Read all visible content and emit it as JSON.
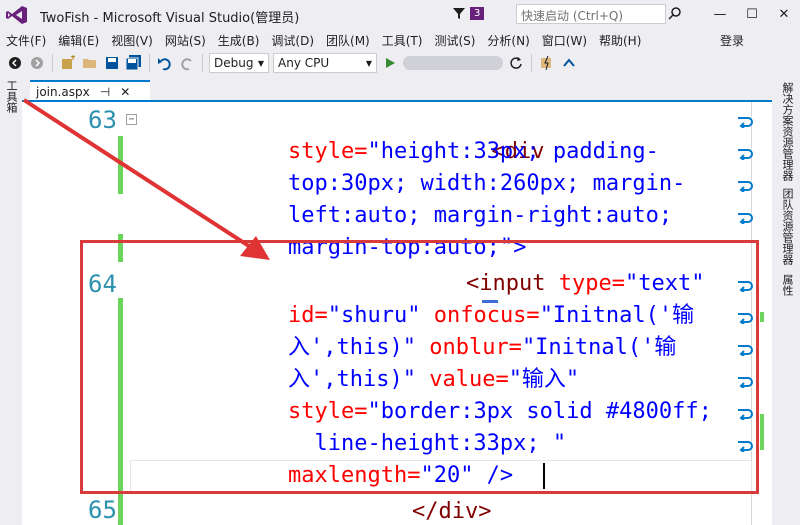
{
  "titlebar": {
    "title": "TwoFish - Microsoft Visual Studio(管理员)",
    "notifications": "3",
    "quick_launch_placeholder": "快速启动 (Ctrl+Q)",
    "minimize": "—",
    "maximize": "☐",
    "close": "✕"
  },
  "menu": {
    "items": [
      "文件(F)",
      "编辑(E)",
      "视图(V)",
      "网站(S)",
      "生成(B)",
      "调试(D)",
      "团队(M)",
      "工具(T)",
      "测试(S)",
      "分析(N)",
      "窗口(W)",
      "帮助(H)"
    ],
    "login": "登录"
  },
  "toolbar": {
    "config": "Debug",
    "platform": "Any CPU"
  },
  "left_strip": {
    "toolbox": "工具箱"
  },
  "right_strip": {
    "tabs": [
      "解决方案资源管理器",
      "团队资源管理器",
      "属性"
    ]
  },
  "tab": {
    "name": "join.aspx",
    "pin": "⊣",
    "close": "✕"
  },
  "editor": {
    "line_numbers": [
      "63",
      "64",
      "65"
    ],
    "code": {
      "l1_tag": "<div",
      "l2_attr": "style=",
      "l2_val": "\"height:33px; padding-",
      "l3_val": "top:30px; width:260px; margin-",
      "l4_val": "left:auto; margin-right:auto;",
      "l5_val": "margin-top:auto;\"",
      "l5_end": ">",
      "l6_tag": "<input",
      "l6_attr": " type=",
      "l6_val": "\"text\"",
      "l7_attr": "id=",
      "l7_val": "\"shuru\"",
      "l7_attr2": " onfocus=",
      "l7_val2": "\"Initnal('输",
      "l8_val": "入',this)\"",
      "l8_attr": " onblur=",
      "l8_val2": "\"Initnal('输",
      "l9_val": "入',this)\"",
      "l9_attr": " value=",
      "l9_val2": "\"输入\"",
      "l10_attr": "style=",
      "l10_val": "\"border:3px solid #4800ff;",
      "l11_val": "  line-height:33px; \"",
      "l12_attr": "maxlength=",
      "l12_val": "\"20\"",
      "l12_end": " />",
      "l13_tag": "</div>"
    }
  },
  "colors": {
    "accent": "#007acc",
    "highlight_border": "#d93a3a",
    "attr_red": "#ff0000",
    "value_blue": "#0000ff",
    "tag_maroon": "#800000",
    "change_green": "#6cd35c",
    "line_number": "#2b91af"
  }
}
